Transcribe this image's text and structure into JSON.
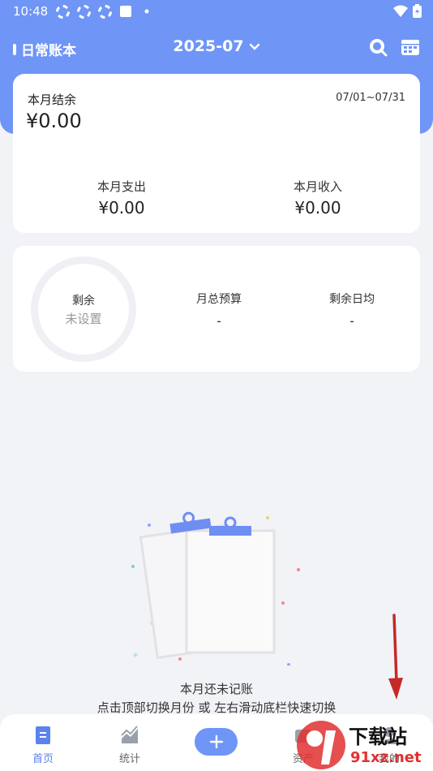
{
  "status_bar": {
    "time": "10:48"
  },
  "header": {
    "book_name": "日常账本",
    "month": "2025-07"
  },
  "summary": {
    "balance_label": "本月结余",
    "date_range": "07/01~07/31",
    "balance_value": "¥0.00",
    "expense_label": "本月支出",
    "expense_value": "¥0.00",
    "income_label": "本月收入",
    "income_value": "¥0.00"
  },
  "budget": {
    "ring_label": "剩余",
    "ring_value": "未设置",
    "monthly_budget_label": "月总预算",
    "monthly_budget_value": "-",
    "daily_avg_label": "剩余日均",
    "daily_avg_value": "-"
  },
  "empty_state": {
    "title": "本月还未记账",
    "hint": "点击顶部切换月份 或 左右滑动底栏快速切换"
  },
  "tabs": [
    {
      "label": "首页",
      "icon": "home-doc-icon",
      "active": true
    },
    {
      "label": "统计",
      "icon": "chart-icon",
      "active": false
    },
    {
      "label": "+",
      "icon": "plus-icon",
      "active": false
    },
    {
      "label": "资产",
      "icon": "wallet-icon",
      "active": false
    },
    {
      "label": "我的",
      "icon": "user-icon",
      "active": false
    }
  ],
  "watermark": {
    "text": "下载站",
    "url": "91xz.net"
  },
  "colors": {
    "accent": "#6f95f6",
    "background": "#f2f3f7",
    "watermark_red": "#e03030"
  }
}
